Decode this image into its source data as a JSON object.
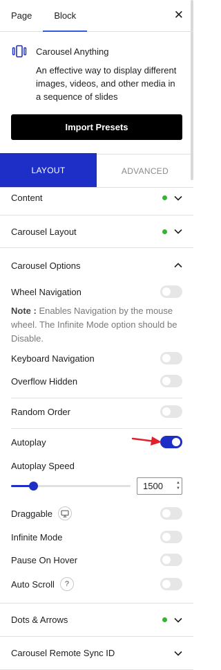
{
  "top_tabs": {
    "page": "Page",
    "block": "Block",
    "close": "✕"
  },
  "block": {
    "icon": "carousel-icon",
    "title": "Carousel Anything",
    "description": "An effective way to display different images, videos, and other media in a sequence of slides",
    "import_button": "Import Presets"
  },
  "layout_tabs": {
    "layout": "LAYOUT",
    "advanced": "ADVANCED"
  },
  "panels": {
    "content": "Content",
    "carousel_layout": "Carousel Layout",
    "carousel_options": "Carousel Options",
    "dots_arrows": "Dots & Arrows",
    "remote_sync": "Carousel Remote Sync ID"
  },
  "options": {
    "wheel_navigation": "Wheel Navigation",
    "note_label": "Note :",
    "note_text": " Enables Navigation by the mouse wheel. The Infinite Mode option should be Disable.",
    "keyboard_navigation": "Keyboard Navigation",
    "overflow_hidden": "Overflow Hidden",
    "random_order": "Random Order",
    "autoplay": "Autoplay",
    "autoplay_speed": "Autoplay Speed",
    "autoplay_speed_value": "1500",
    "draggable": "Draggable",
    "infinite_mode": "Infinite Mode",
    "pause_on_hover": "Pause On Hover",
    "auto_scroll": "Auto Scroll",
    "help_glyph": "?"
  },
  "colors": {
    "accent": "#1e2fc7",
    "dot": "#2fb82f",
    "arrow": "#e0202a"
  }
}
